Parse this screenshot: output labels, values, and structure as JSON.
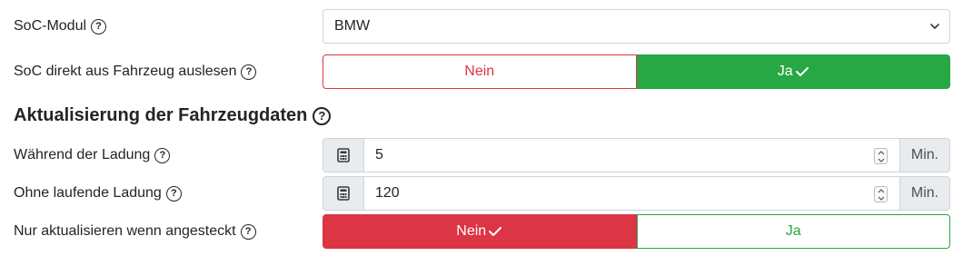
{
  "soc_module": {
    "label": "SoC-Modul",
    "help_icon": "question-circle-icon",
    "selected": "BMW"
  },
  "read_soc_direct": {
    "label": "SoC direkt aus Fahrzeug auslesen",
    "no_label": "Nein",
    "yes_label": "Ja",
    "selected": "Ja"
  },
  "update_section": {
    "title": "Aktualisierung der Fahrzeugdaten"
  },
  "during_charge": {
    "label": "Während der Ladung",
    "value": "5",
    "unit": "Min.",
    "prefix_icon": "calculator-icon"
  },
  "without_charge": {
    "label": "Ohne laufende Ladung",
    "value": "120",
    "unit": "Min.",
    "prefix_icon": "calculator-icon"
  },
  "update_when_plugged": {
    "label": "Nur aktualisieren wenn angesteckt",
    "no_label": "Nein",
    "yes_label": "Ja",
    "selected": "Nein"
  },
  "colors": {
    "success": "#28a745",
    "danger": "#dc3545",
    "addon_bg": "#e9ecef",
    "border": "#ced4da"
  }
}
